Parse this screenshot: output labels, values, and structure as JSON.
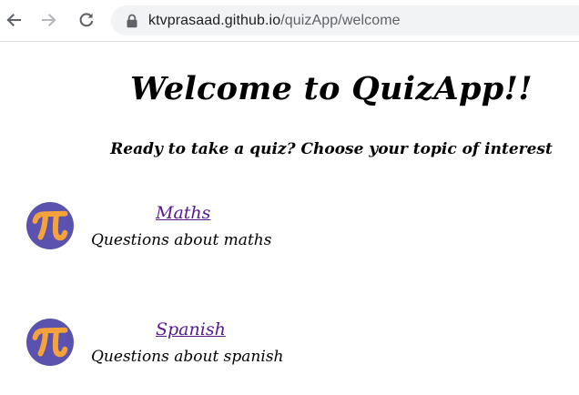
{
  "browser": {
    "url_domain": "ktvprasaad.github.io",
    "url_path": "/quizApp/welcome"
  },
  "page": {
    "title": "Welcome to QuizApp!!",
    "subtitle": "Ready to take a quiz? Choose your topic of interest"
  },
  "topics": [
    {
      "name": "Maths",
      "description": "Questions about maths",
      "icon": "pi-icon"
    },
    {
      "name": "Spanish",
      "description": "Questions about spanish",
      "icon": "pi-icon"
    }
  ],
  "colors": {
    "link": "#551a8b",
    "icon_background": "#5b52b0",
    "icon_glyph": "#f6a23a"
  }
}
